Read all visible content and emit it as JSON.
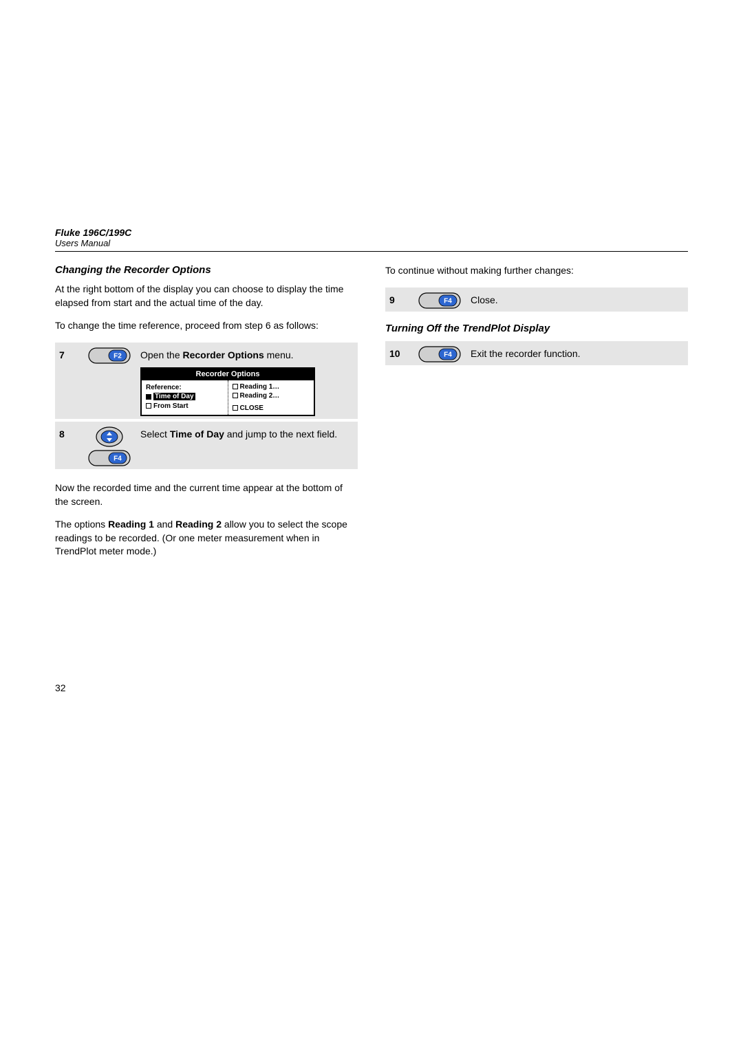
{
  "product": "Fluke 196C/199C",
  "manual": "Users Manual",
  "page_number": "32",
  "left": {
    "section_title": "Changing the Recorder Options",
    "para1": "At the right bottom of the display you can choose to display the time elapsed from start and the actual time of the day.",
    "para2": "To change the time reference, proceed from step 6 as follows:",
    "step7": {
      "num": "7",
      "key": "F2",
      "text_pre": "Open the ",
      "text_bold": "Recorder Options",
      "text_post": " menu."
    },
    "recorder_menu": {
      "title": "Recorder Options",
      "ref_label": "Reference:",
      "opt1": "Time of Day",
      "opt2": "From Start",
      "ropt1": "Reading 1…",
      "ropt2": "Reading 2…",
      "close": "CLOSE"
    },
    "step8": {
      "num": "8",
      "key": "F4",
      "text_pre": "Select ",
      "text_bold": "Time of Day",
      "text_post": " and jump to the next field."
    },
    "para3": "Now the recorded time and the current time appear at the bottom of the screen.",
    "para4_pre": "The options ",
    "para4_b1": "Reading 1",
    "para4_mid": " and ",
    "para4_b2": "Reading 2",
    "para4_post": " allow you to select the scope readings to be recorded. (Or one meter measurement when in TrendPlot meter mode.)"
  },
  "right": {
    "intro": "To continue without making further changes:",
    "step9": {
      "num": "9",
      "key": "F4",
      "text": "Close."
    },
    "section_title": "Turning Off the TrendPlot Display",
    "step10": {
      "num": "10",
      "key": "F4",
      "text": "Exit the recorder function."
    }
  }
}
